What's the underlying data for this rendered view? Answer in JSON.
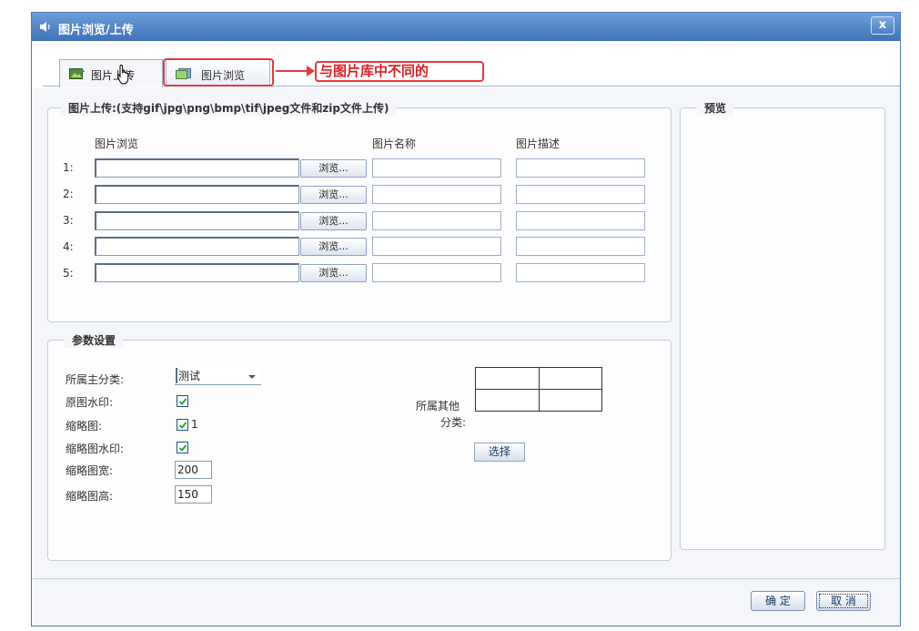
{
  "window": {
    "title": "图片浏览/上传",
    "close_label": "x"
  },
  "tabs": [
    {
      "label": "图片上传",
      "active": true
    },
    {
      "label": "图片浏览",
      "active": false
    }
  ],
  "annotation": {
    "callout": "与图片库中不同的",
    "color": "#e43a3a"
  },
  "upload": {
    "legend": "图片上传:(支持gif\\jpg\\png\\bmp\\tif\\jpeg文件和zip文件上传)",
    "columns": {
      "browse": "图片浏览",
      "name": "图片名称",
      "desc": "图片描述"
    },
    "browse_label": "浏览...",
    "rows": [
      {
        "num": "1:"
      },
      {
        "num": "2:"
      },
      {
        "num": "3:"
      },
      {
        "num": "4:"
      },
      {
        "num": "5:"
      }
    ]
  },
  "params": {
    "legend": "参数设置",
    "main_category_label": "所属主分类:",
    "main_category_value": "测试",
    "watermark_label": "原图水印:",
    "thumbnail_label": "缩略图:",
    "thumbnail_extra": "1",
    "thumb_watermark_label": "缩略图水印:",
    "thumb_width_label": "缩略图宽:",
    "thumb_width_value": "200",
    "thumb_height_label": "缩略图高:",
    "thumb_height_value": "150",
    "other_category_label1": "所属其他",
    "other_category_label2": "分类:",
    "select_label": "选择"
  },
  "preview": {
    "legend": "预览"
  },
  "footer": {
    "ok_label": "确 定",
    "cancel_label": "取 消"
  },
  "colors": {
    "title_bar": "#4a7bb8",
    "accent": "#e43a3a"
  }
}
